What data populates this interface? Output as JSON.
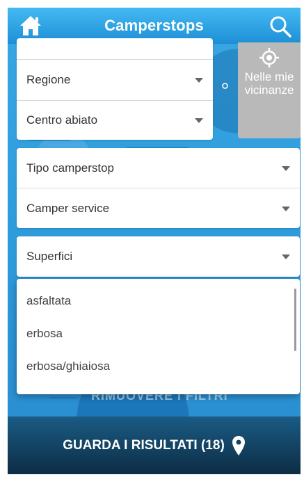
{
  "header": {
    "title": "Camperstops",
    "home_icon": "home-icon",
    "search_icon": "search-icon"
  },
  "filters": {
    "region_label": "Regione",
    "town_label": "Centro abiato",
    "near_me_label": "Nelle mie vicinanze",
    "type_label": "Tipo camperstop",
    "service_label": "Camper service",
    "surface_label": "Superfici"
  },
  "surface_options": [
    "asfaltata",
    "erbosa",
    "erbosa/ghiaiosa"
  ],
  "background_text": "RIMUOVERE I FILTRI",
  "footer": {
    "cta_label": "GUARDA I RISULTATI (18)",
    "cta_icon": "map-pin-icon"
  },
  "colors": {
    "accent": "#2e9fdc",
    "header_top": "#45b9f2",
    "footer": "#0d2d44",
    "near_button": "#b9b9b9"
  }
}
